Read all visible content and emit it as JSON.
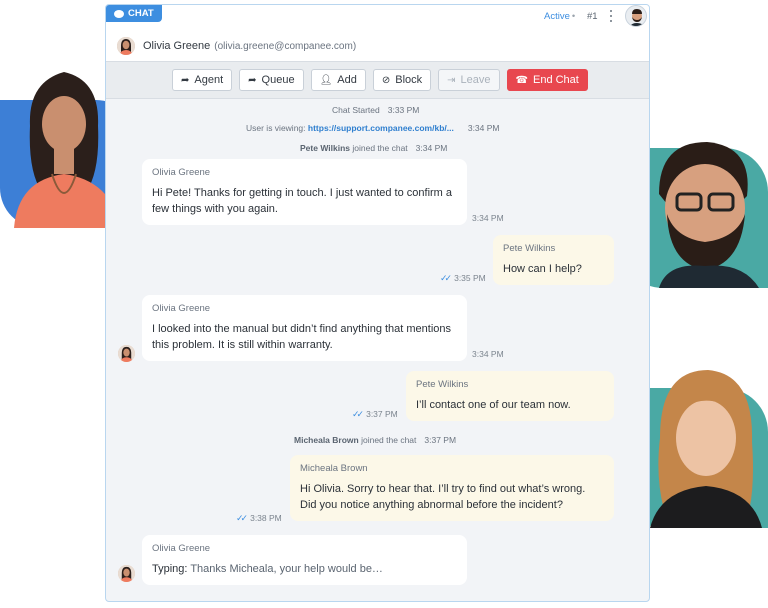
{
  "header": {
    "tab_label": "CHAT",
    "status": "Active",
    "status_dot": "•",
    "ticket": "#1"
  },
  "contact": {
    "name": "Olivia Greene",
    "email": "(olivia.greene@companee.com)"
  },
  "toolbar": {
    "agent": "Agent",
    "queue": "Queue",
    "add": "Add",
    "block": "Block",
    "leave": "Leave",
    "end_chat": "End Chat"
  },
  "system": {
    "started_label": "Chat Started",
    "started_time": "3:33 PM",
    "viewing_label": "User is viewing:",
    "viewing_url": "https://support.companee.com/kb/...",
    "viewing_time": "3:34 PM",
    "join1_name": "Pete Wilkins",
    "join1_text": "joined the chat",
    "join1_time": "3:34 PM",
    "join2_name": "Micheala Brown",
    "join2_text": "joined the chat",
    "join2_time": "3:37 PM"
  },
  "messages": [
    {
      "author": "Olivia Greene",
      "text": "Hi Pete! Thanks for getting in touch. I just wanted to confirm a few things with you again.",
      "time": "3:34 PM"
    },
    {
      "author": "Pete Wilkins",
      "text": "How can I help?",
      "time": "3:35 PM"
    },
    {
      "author": "Olivia Greene",
      "text": "I looked into the manual but didn’t find anything that mentions this problem. It is still within warranty.",
      "time": "3:34 PM"
    },
    {
      "author": "Pete Wilkins",
      "text": "I’ll contact one of our team now.",
      "time": "3:37 PM"
    },
    {
      "author": "Micheala Brown",
      "text": "Hi Olivia. Sorry to hear that. I’ll try to find out what’s wrong. Did you notice anything abnormal before the incident?",
      "time": "3:38 PM"
    },
    {
      "author": "Olivia Greene",
      "typing_label": "Typing:",
      "text": "Thanks Micheala, your help would be…"
    }
  ],
  "colors": {
    "accent": "#3d8ee0",
    "danger": "#e8474f",
    "agent_bubble": "#fcf8e8",
    "panel_bg": "#f2f4f7"
  }
}
